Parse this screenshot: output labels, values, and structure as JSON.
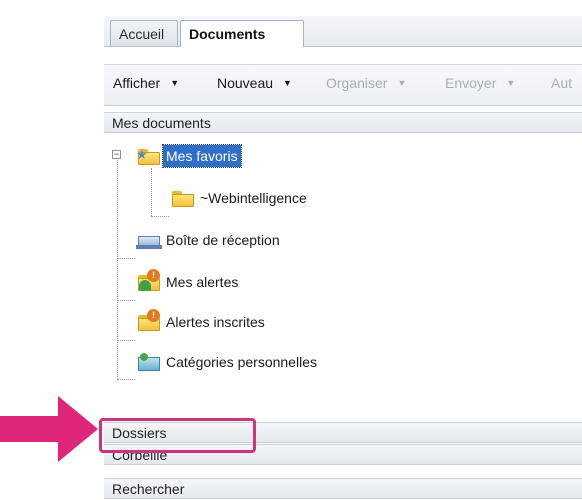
{
  "tabs": [
    {
      "label": "Accueil"
    },
    {
      "label": "Documents",
      "active": true
    }
  ],
  "toolbar": {
    "items": [
      {
        "label": "Afficher",
        "enabled": true
      },
      {
        "label": "Nouveau",
        "enabled": true
      },
      {
        "label": "Organiser",
        "enabled": false
      },
      {
        "label": "Envoyer",
        "enabled": false
      },
      {
        "label": "Aut",
        "enabled": false
      }
    ],
    "dropdown_glyph": "▼"
  },
  "sections": {
    "mes_documents": "Mes documents",
    "dossiers": "Dossiers",
    "corbeille": "Corbeille",
    "rechercher": "Rechercher"
  },
  "tree": {
    "expander_glyph": "−",
    "items": [
      {
        "label": "Mes favoris",
        "icon": "favorites-folder-icon",
        "selected": true
      },
      {
        "label": "~Webintelligence",
        "icon": "folder-icon"
      },
      {
        "label": "Boîte de réception",
        "icon": "inbox-icon"
      },
      {
        "label": "Mes alertes",
        "icon": "alerts-icon"
      },
      {
        "label": "Alertes inscrites",
        "icon": "subscribed-alerts-icon"
      },
      {
        "label": "Catégories personnelles",
        "icon": "personal-categories-icon"
      }
    ]
  },
  "annotation": {
    "arrow_color": "#e0267a",
    "highlight_color": "#d0337e"
  },
  "colors": {
    "selection": "#2f6fc7"
  }
}
